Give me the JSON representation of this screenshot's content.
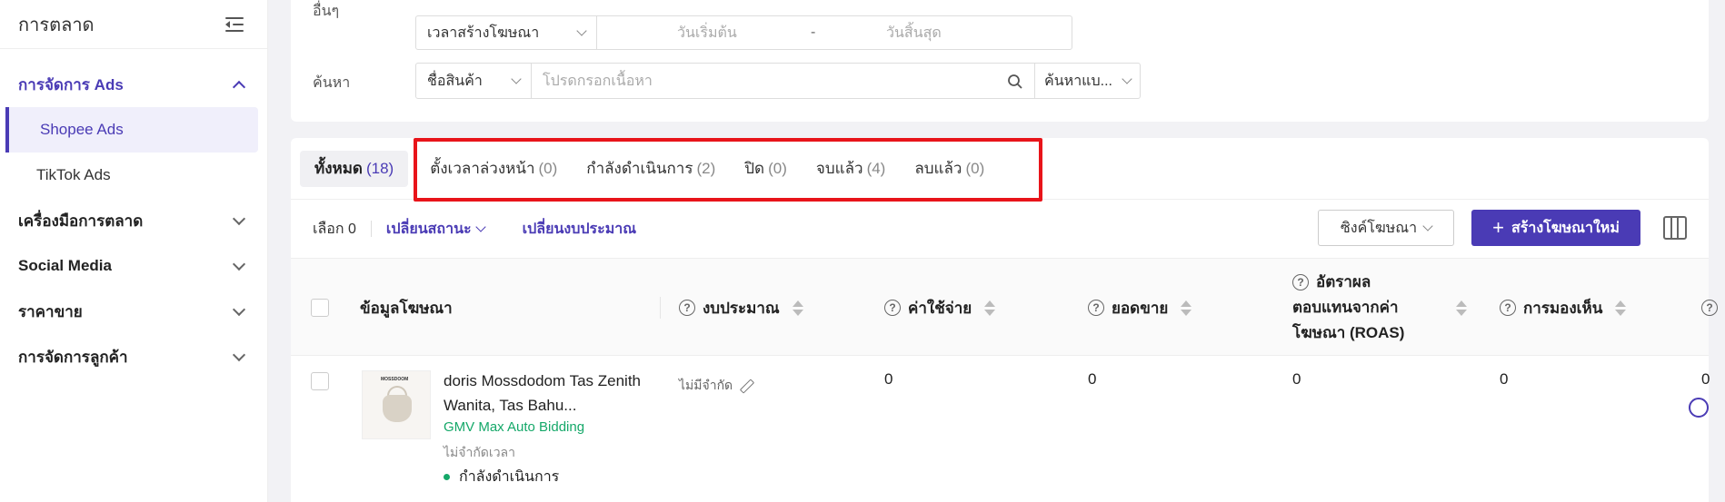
{
  "sidebar": {
    "title": "การตลาด",
    "sections": [
      {
        "label": "การจัดการ Ads",
        "children": [
          "Shopee Ads",
          "TikTok Ads"
        ]
      },
      {
        "label": "เครื่องมือการตลาด"
      },
      {
        "label": "Social Media"
      },
      {
        "label": "ราคาขาย"
      },
      {
        "label": "การจัดการลูกค้า"
      }
    ]
  },
  "filters": {
    "other_label": "อื่นๆ",
    "date_type": "เวลาสร้างโฆษณา",
    "start_placeholder": "วันเริ่มต้น",
    "date_sep": "-",
    "end_placeholder": "วันสิ้นสุด",
    "search_label": "ค้นหา",
    "search_field": "ชื่อสินค้า",
    "search_placeholder": "โปรดกรอกเนื้อหา",
    "search_mode": "ค้นหาแบ..."
  },
  "tabs": [
    {
      "label": "ทั้งหมด",
      "count": "(18)"
    },
    {
      "label": "ตั้งเวลาล่วงหน้า",
      "count": "(0)"
    },
    {
      "label": "กำลังดำเนินการ",
      "count": "(2)"
    },
    {
      "label": "ปิด",
      "count": "(0)"
    },
    {
      "label": "จบแล้ว",
      "count": "(4)"
    },
    {
      "label": "ลบแล้ว",
      "count": "(0)"
    }
  ],
  "toolbar": {
    "selected": "เลือก 0",
    "change_status": "เปลี่ยนสถานะ",
    "change_budget": "เปลี่ยนงบประมาณ",
    "sync": "ซิงค์โฆษณา",
    "create": "สร้างโฆษณาใหม่"
  },
  "table": {
    "headers": {
      "info": "ข้อมูลโฆษณา",
      "budget": "งบประมาณ",
      "spend": "ค่าใช้จ่าย",
      "sales": "ยอดขาย",
      "roas_l1": "อัตราผล",
      "roas_l2": "ตอบแทนจากค่า",
      "roas_l3": "โฆษณา (ROAS)",
      "impressions": "การมองเห็น"
    },
    "rows": [
      {
        "brand": "MOSSDOOM",
        "title": "doris Mossdodom Tas Zenith Wanita, Tas Bahu...",
        "bidding": "GMV Max Auto Bidding",
        "time": "ไม่จำกัดเวลา",
        "status": "กำลังดำเนินการ",
        "budget": "ไม่มีจำกัด",
        "spend": "0",
        "sales": "0",
        "roas": "0",
        "impressions": "0",
        "partial": "0"
      }
    ]
  },
  "colors": {
    "accent": "#4a3bb5",
    "highlight": "#e8141a",
    "success": "#15a869"
  }
}
